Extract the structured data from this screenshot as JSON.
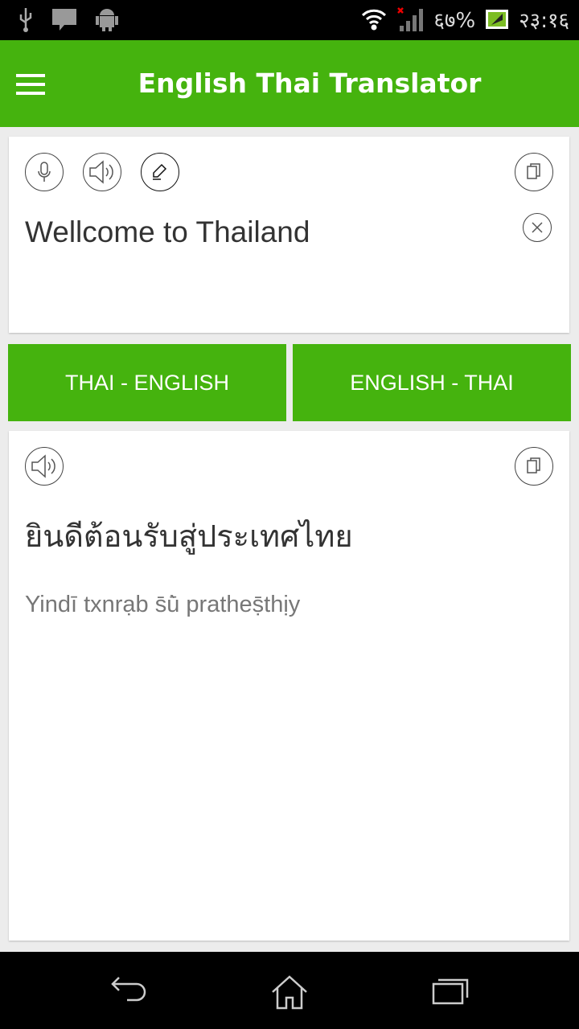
{
  "status_bar": {
    "battery": "६७%",
    "time": "२३:१६",
    "icons": [
      "usb-icon",
      "message-icon",
      "android-icon",
      "wifi-icon",
      "signal-icon",
      "battery-icon"
    ]
  },
  "app_bar": {
    "title": "English Thai Translator",
    "menu_icon": "hamburger-icon"
  },
  "input_card": {
    "text": "Wellcome to Thailand",
    "icons": [
      "microphone-icon",
      "speaker-icon",
      "pen-icon",
      "copy-icon",
      "clear-icon"
    ]
  },
  "buttons": {
    "thai_english": "THAI - ENGLISH",
    "english_thai": "ENGLISH - THAI"
  },
  "output_card": {
    "thai": "ยินดีต้อนรับสู่ประเทศไทย",
    "romanization": "Yindī txnrạb s̄ū̀ pratheṣ̄thịy",
    "icons": [
      "speaker-icon",
      "copy-icon"
    ]
  },
  "colors": {
    "accent": "#45b30e"
  },
  "nav_bar": {
    "icons": [
      "back-icon",
      "home-icon",
      "recent-apps-icon"
    ]
  }
}
